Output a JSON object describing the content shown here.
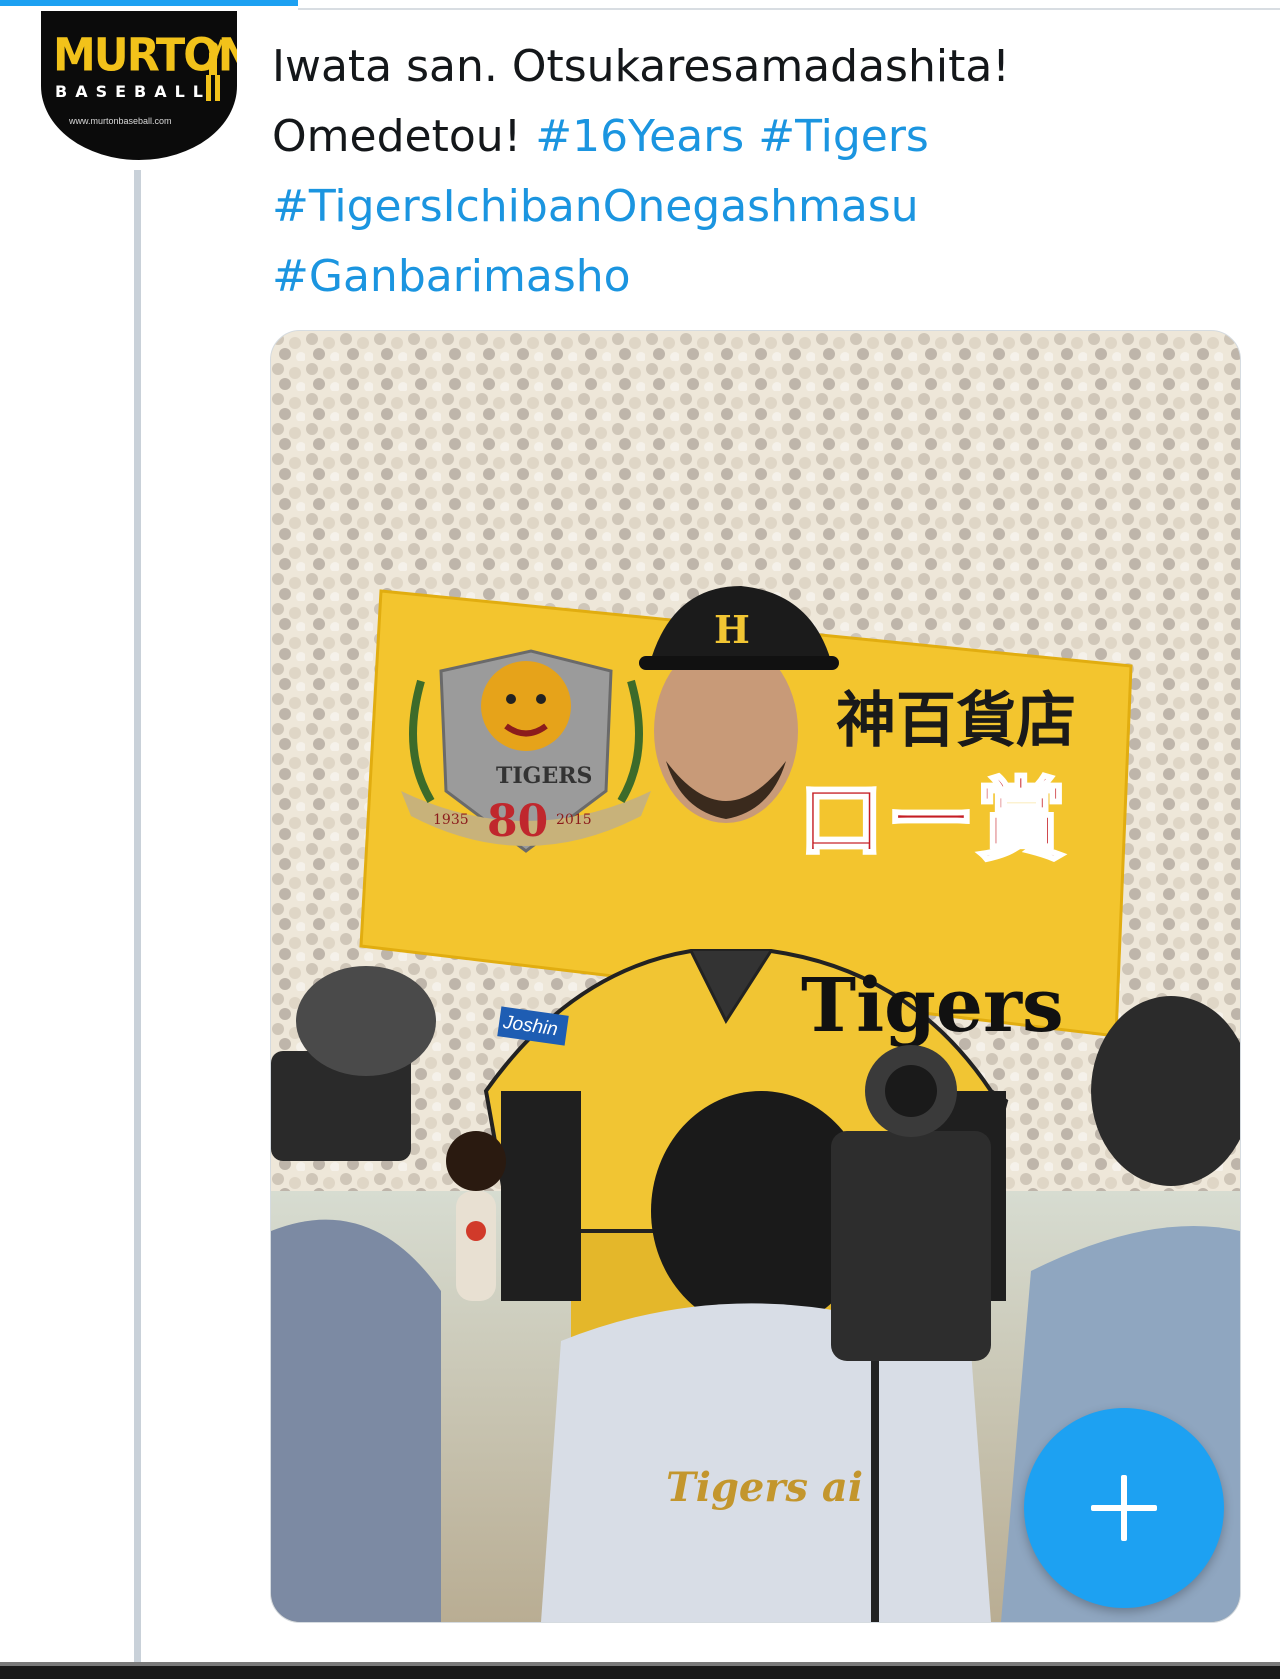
{
  "avatar": {
    "brand": "MURTON",
    "sub": "BASEBALL",
    "url": "www.murtonbaseball.com"
  },
  "tweet": {
    "line1": "Iwata san. Otsukaresamadashita!",
    "line2_text": "Omedetou!",
    "line2_tag1": "#16Years",
    "line2_tag2": "#Tigers",
    "line3_tag": "#TigersIchibanOnegashmasu",
    "line4_tag": "#Ganbarimasho"
  },
  "media": {
    "banner_logo_text": "TIGERS",
    "banner_logo_number": "80",
    "banner_logo_year_left": "1935",
    "banner_logo_year_right": "2015",
    "banner_text_top": "神百貨店",
    "banner_text_big": "ロー賞",
    "jersey_text": "Tigers",
    "sleeve_patch": "Joshin",
    "vest_text": "Tigers ai"
  },
  "fab": {
    "icon": "plus-icon"
  },
  "colors": {
    "accent": "#1da1f2",
    "hashtag": "#1b95e0",
    "tigers_yellow": "#f2c21a"
  }
}
